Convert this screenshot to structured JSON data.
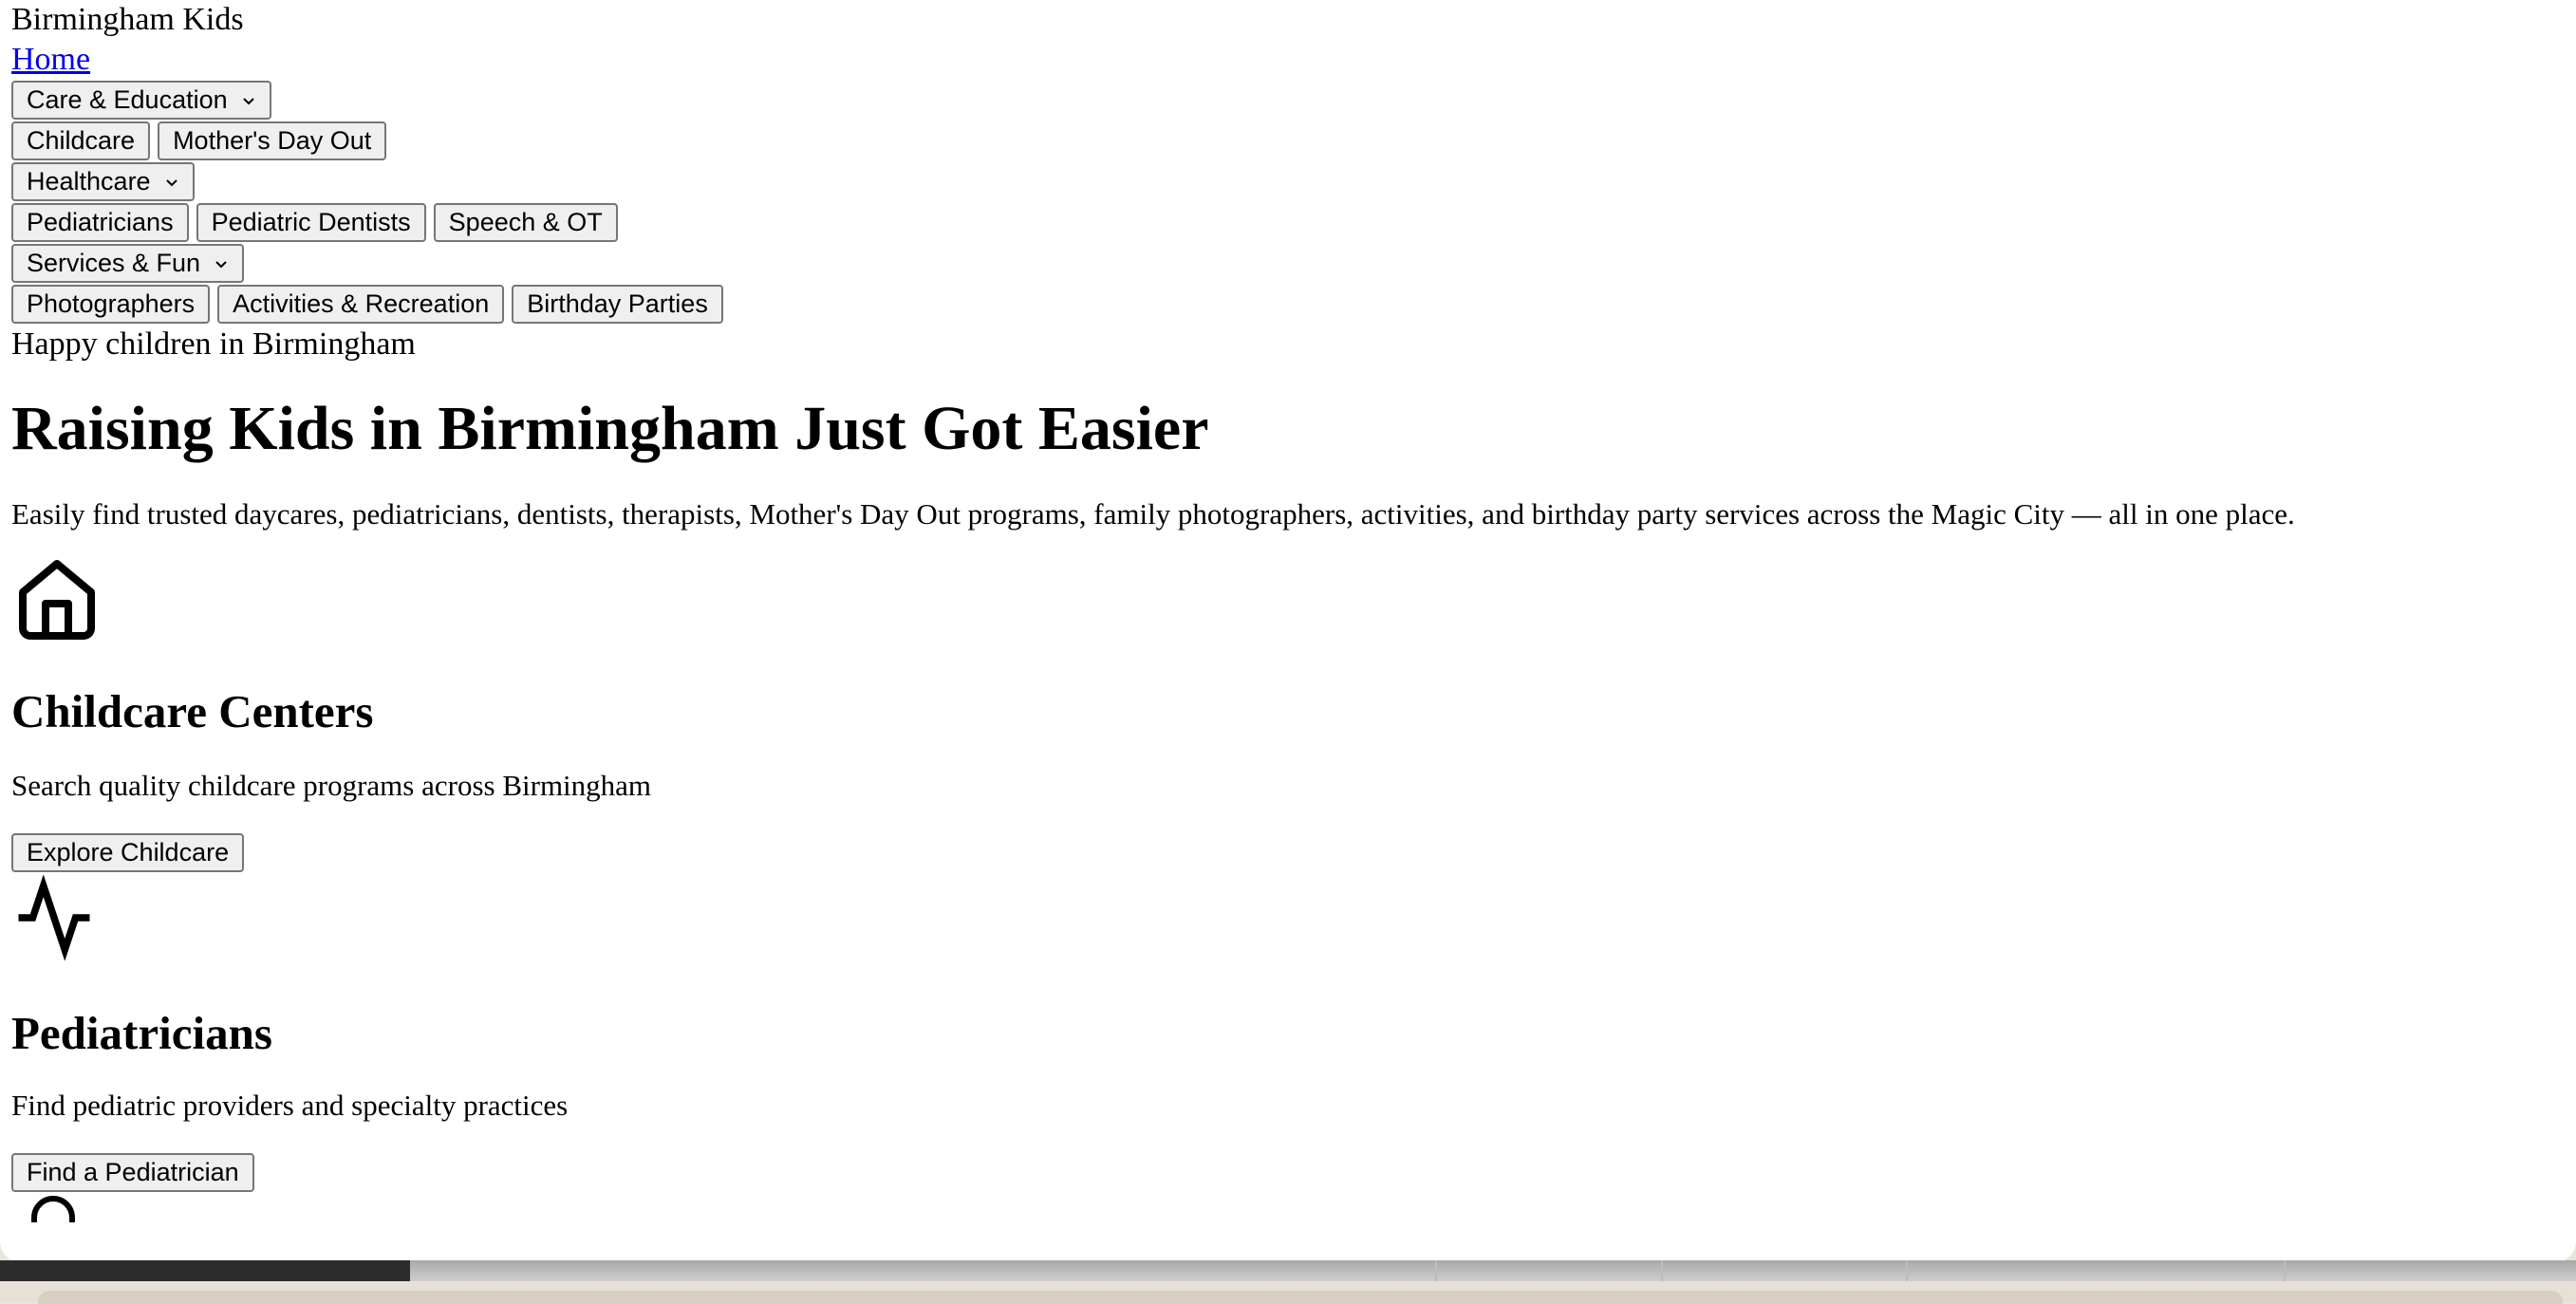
{
  "header": {
    "logo_alt": "Birmingham Kids",
    "home_link": "Home"
  },
  "nav": {
    "groups": [
      {
        "label": "Care & Education",
        "items": [
          "Childcare",
          "Mother's Day Out"
        ]
      },
      {
        "label": "Healthcare",
        "items": [
          "Pediatricians",
          "Pediatric Dentists",
          "Speech & OT"
        ]
      },
      {
        "label": "Services & Fun",
        "items": [
          "Photographers",
          "Activities & Recreation",
          "Birthday Parties"
        ]
      }
    ]
  },
  "hero": {
    "image_alt": "Happy children in Birmingham",
    "title": "Raising Kids in Birmingham Just Got Easier",
    "subtitle": "Easily find trusted daycares, pediatricians, dentists, therapists, Mother's Day Out programs, family photographers, activities, and birthday party services across the Magic City — all in one place."
  },
  "cards": [
    {
      "icon": "home-icon",
      "title": "Childcare Centers",
      "description": "Search quality childcare programs across Birmingham",
      "button": "Explore Childcare"
    },
    {
      "icon": "activity-icon",
      "title": "Pediatricians",
      "description": "Find pediatric providers and specialty practices",
      "button": "Find a Pediatrician"
    }
  ],
  "colors": {
    "link": "#0000ee",
    "button_bg": "#efefef",
    "button_border": "#767676"
  }
}
